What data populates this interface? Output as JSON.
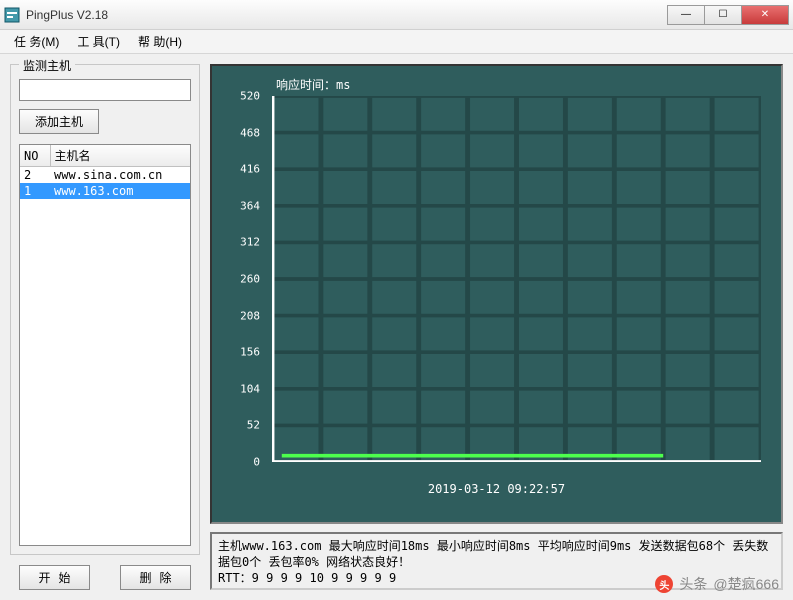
{
  "window": {
    "title": "PingPlus V2.18"
  },
  "menu": {
    "task": "任 务(M)",
    "tool": "工 具(T)",
    "help": "帮 助(H)"
  },
  "sidebar": {
    "legend": "监测主机",
    "addhost_label": "添加主机",
    "col_no": "NO",
    "col_host": "主机名",
    "rows": [
      {
        "no": "2",
        "host": "www.sina.com.cn",
        "selected": false
      },
      {
        "no": "1",
        "host": "www.163.com",
        "selected": true
      }
    ],
    "start_label": "开始",
    "delete_label": "删除"
  },
  "chart_data": {
    "type": "line",
    "title": "响应时间：ms",
    "ylabel": "ms",
    "ylim": [
      0,
      520
    ],
    "yticks": [
      0,
      52,
      104,
      156,
      208,
      260,
      312,
      364,
      416,
      468,
      520
    ],
    "timestamp": "2019-03-12  09:22:57",
    "series": [
      {
        "name": "www.163.com",
        "approx_value": 9,
        "packets": 68
      }
    ],
    "note": "flat low-value line near y=0 spanning most of the time axis"
  },
  "status": {
    "line1": "主机www.163.com  最大响应时间18ms  最小响应时间8ms  平均响应时间9ms  发送数据包68个  丢失数据包0个  丢包率0%  网络状态良好！",
    "line2": "RTT：9 9 9 9 10 9 9 9 9 9"
  },
  "watermark": {
    "prefix": "头条",
    "user": "@楚疯666"
  }
}
